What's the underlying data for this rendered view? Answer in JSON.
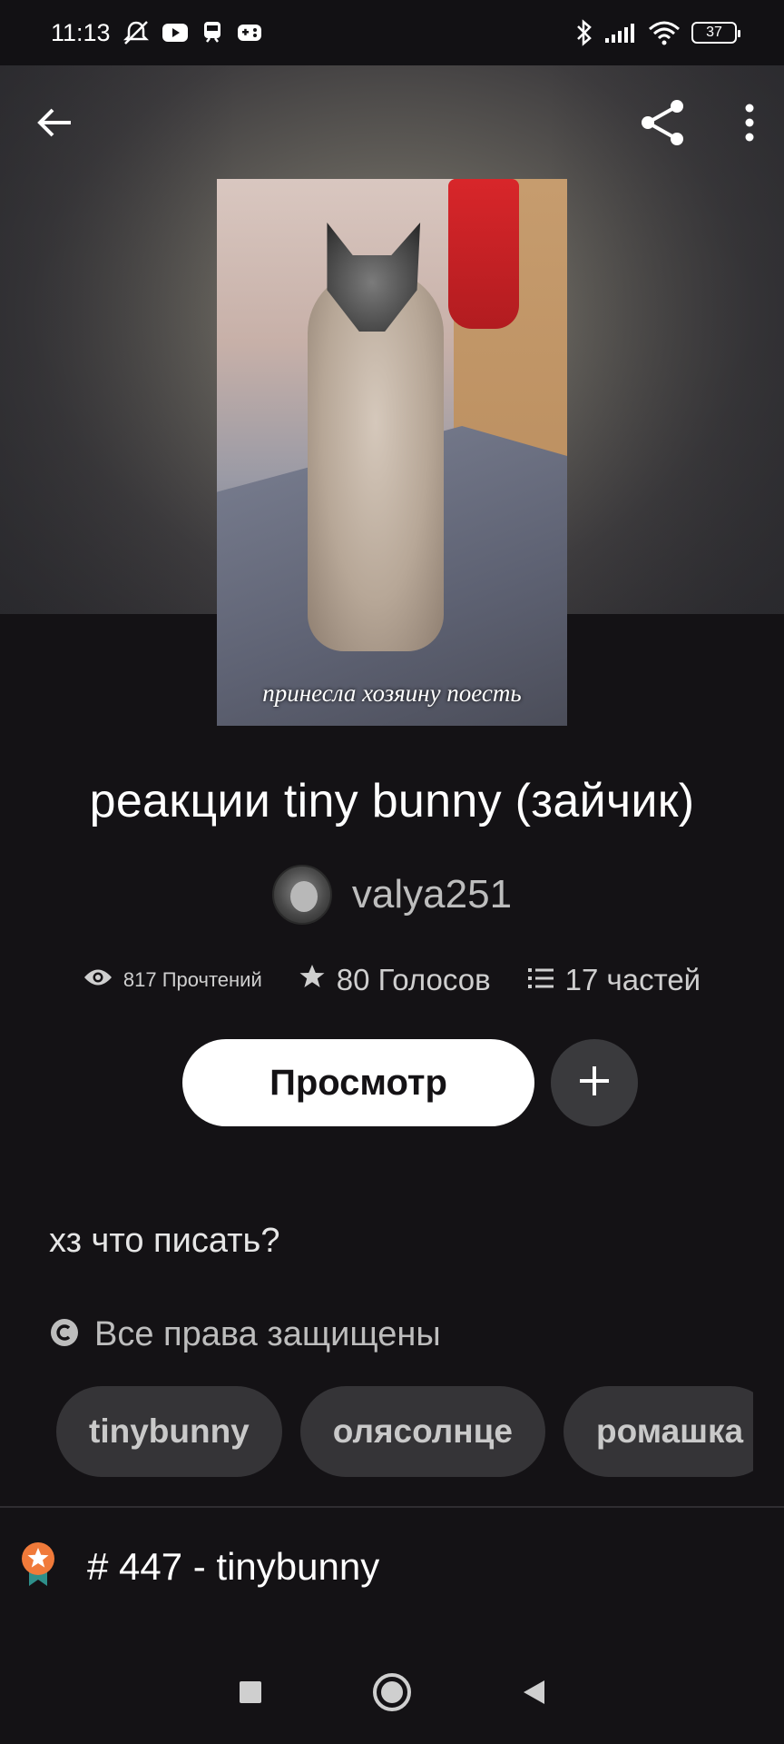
{
  "status_bar": {
    "time": "11:13",
    "battery": "37"
  },
  "cover": {
    "caption": "принесла хозяину поесть"
  },
  "story": {
    "title": "реакции tiny bunny (зайчик)",
    "author": "valya251",
    "reads": "817 Прочтений",
    "votes": "80 Голосов",
    "parts": "17 частей",
    "read_button": "Просмотр",
    "description": "хз что писать?",
    "license": "Все права защищены",
    "tags": [
      "tinybunny",
      "олясолнце",
      "ромашка"
    ],
    "rank": "# 447 - tinybunny"
  },
  "colors": {
    "background": "#141215",
    "accent_badge": "#f07a3a",
    "ribbon": "#2e8f8a"
  }
}
